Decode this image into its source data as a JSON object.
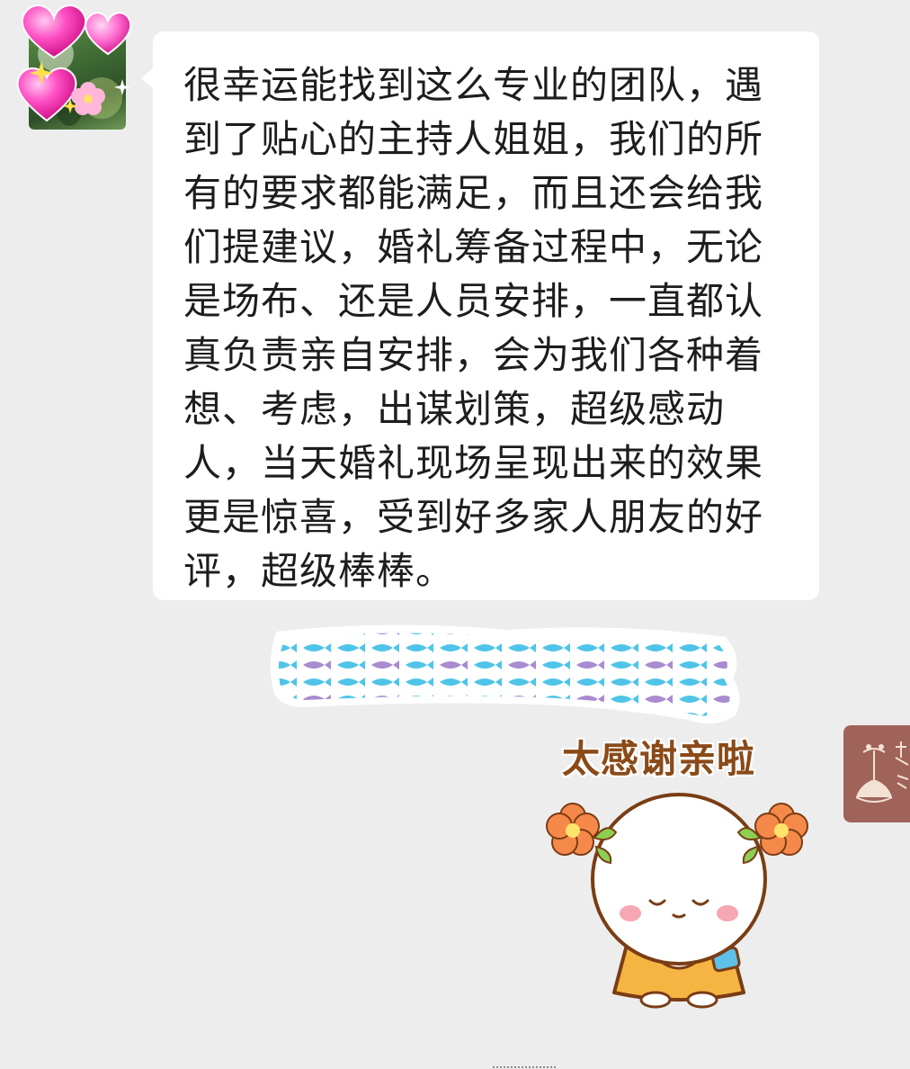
{
  "conversation": {
    "message": {
      "sender_avatar": "pink-hearts-sparkle-avatar",
      "text": "很幸运能找到这么专业的团队，遇到了贴心的主持人姐姐，我们的所有的要求都能满足，而且还会给我们提建议，婚礼筹备过程中，无论是场布、还是人员安排，一直都认真负责亲自安排，会为我们各种着想、考虑，出谋划策，超级感动人，当天婚礼现场呈现出来的效果更是惊喜，受到好多家人朋友的好评，超级棒棒。"
    },
    "sticker": {
      "caption": "太感谢亲啦",
      "mascot": "bowing-round-face-with-orange-flowers",
      "colors": {
        "caption": "#8a4a18",
        "dress": "#f6b443",
        "flower": "#f5894a",
        "banner_blue": "#4fc4e8",
        "banner_purple": "#a98bd0"
      }
    }
  },
  "floating_tab": {
    "icon": "floral-brand-logo-icon"
  },
  "theme": {
    "background": "#ededed",
    "bubble": "#ffffff",
    "text": "#1d1d1d"
  }
}
